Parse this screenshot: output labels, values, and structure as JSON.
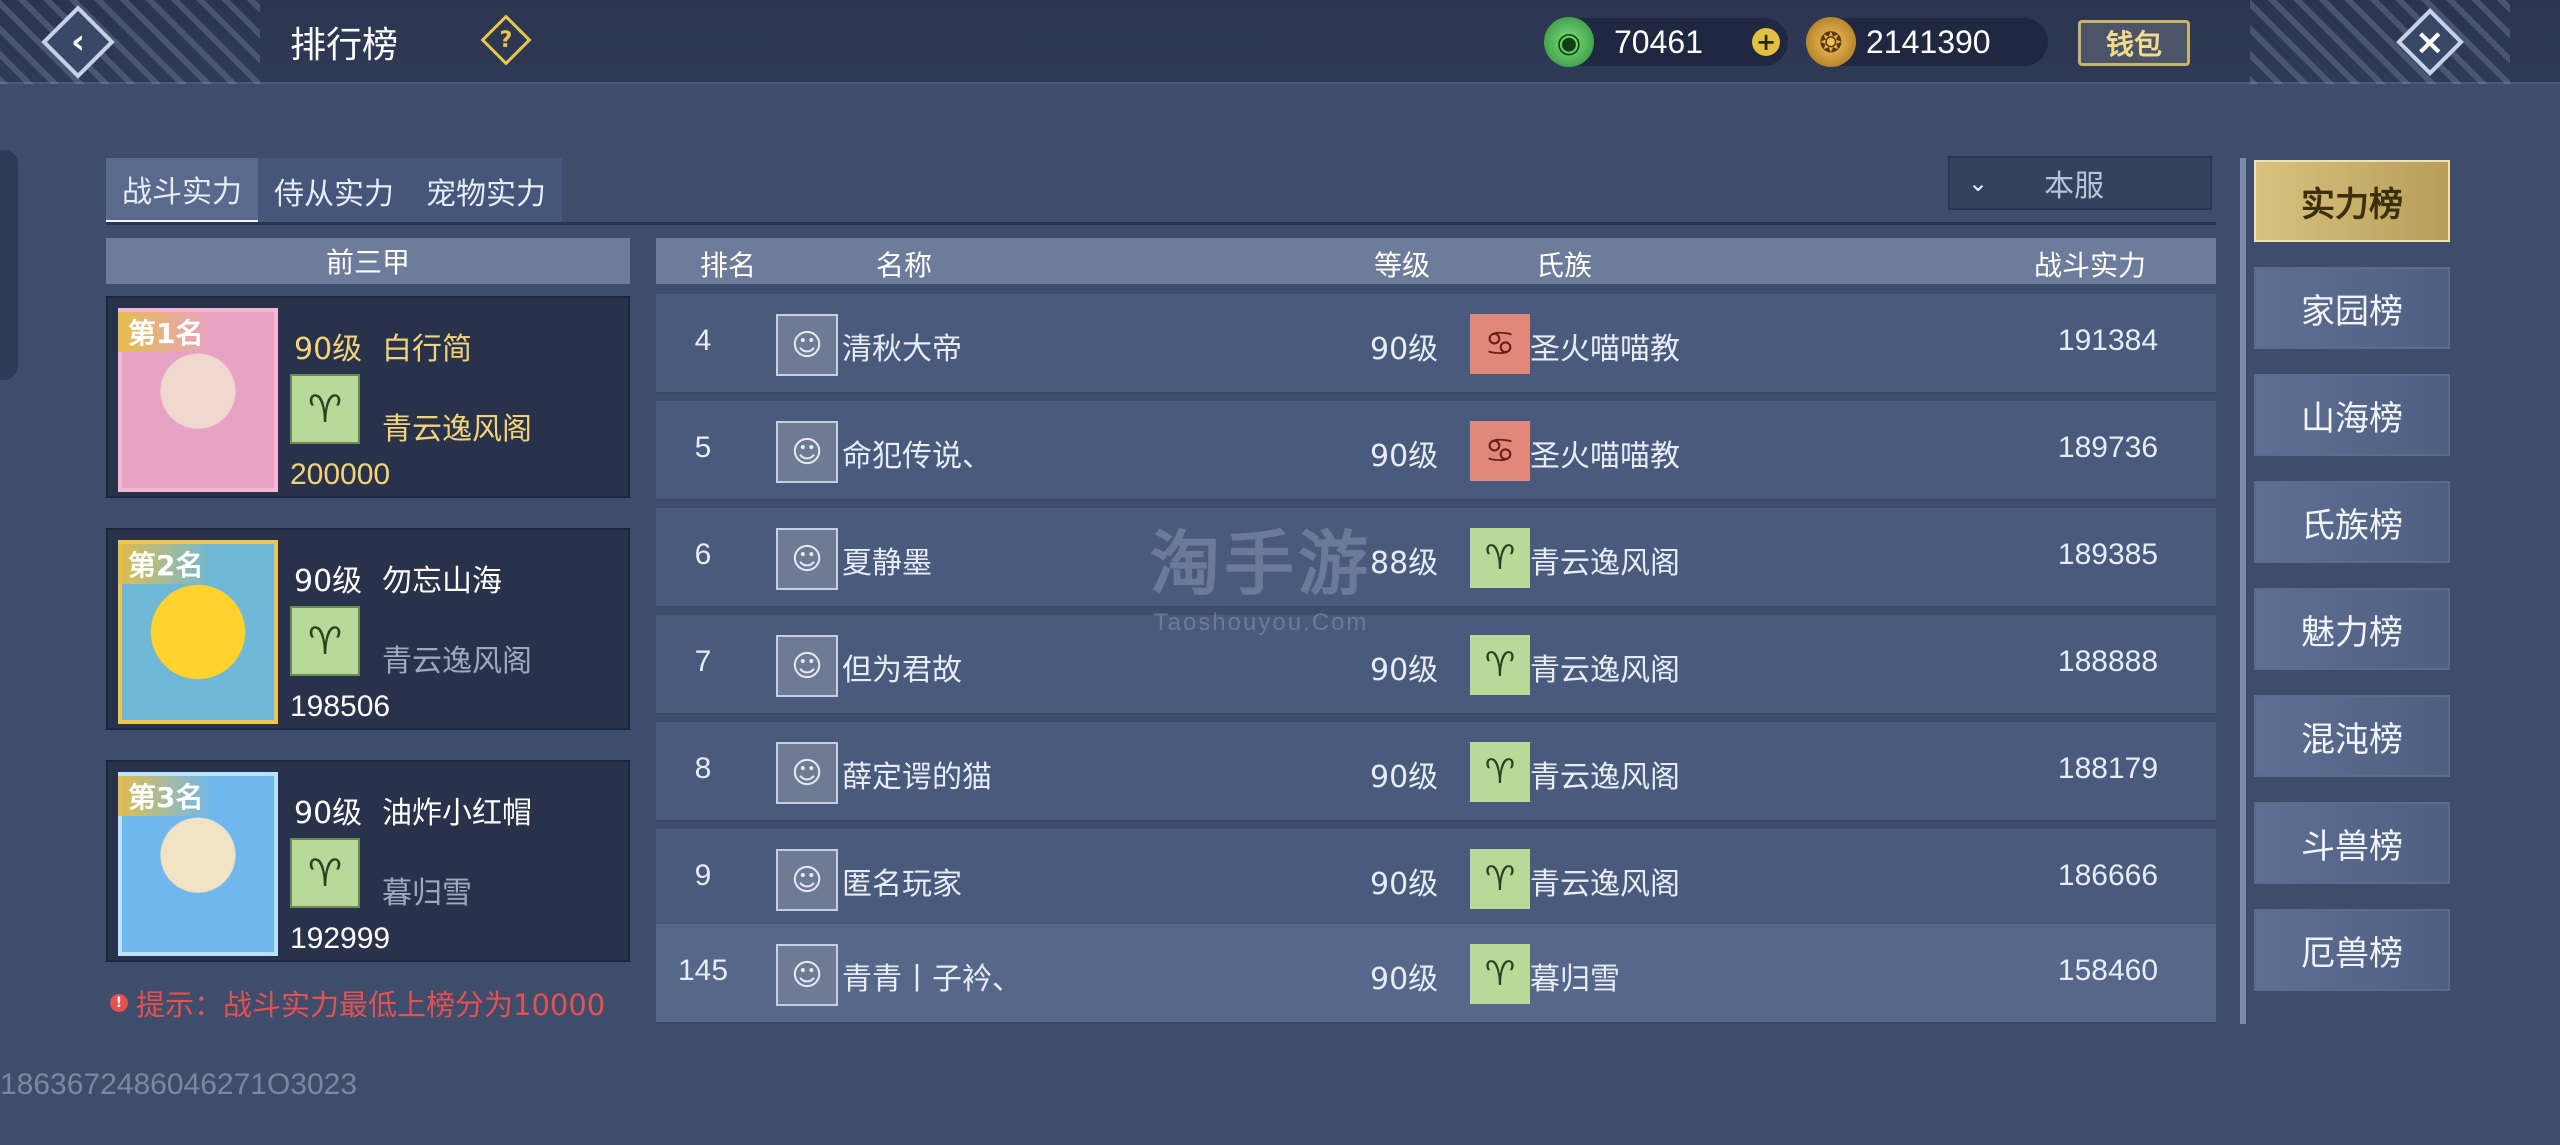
{
  "header": {
    "title": "排行榜",
    "jade_amount": "70461",
    "gold_amount": "2141390",
    "wallet_label": "钱包"
  },
  "tabs": [
    {
      "label": "战斗实力",
      "active": true
    },
    {
      "label": "侍从实力",
      "active": false
    },
    {
      "label": "宠物实力",
      "active": false
    }
  ],
  "server_filter": {
    "value": "本服"
  },
  "top_three": {
    "header": "前三甲",
    "entries": [
      {
        "rank_label": "第1名",
        "level": "90级",
        "name": "白行简",
        "clan": "青云逸风阁",
        "power": "200000"
      },
      {
        "rank_label": "第2名",
        "level": "90级",
        "name": "勿忘山海",
        "clan": "青云逸风阁",
        "power": "198506"
      },
      {
        "rank_label": "第3名",
        "level": "90级",
        "name": "油炸小红帽",
        "clan": "暮归雪",
        "power": "192999"
      }
    ]
  },
  "table": {
    "columns": [
      "排名",
      "名称",
      "等级",
      "氏族",
      "战斗实力"
    ],
    "rows": [
      {
        "rank": "4",
        "name": "清秋大帝",
        "level": "90级",
        "clan": "圣火喵喵教",
        "power": "191384",
        "clan_color": "red"
      },
      {
        "rank": "5",
        "name": "命犯传说、",
        "level": "90级",
        "clan": "圣火喵喵教",
        "power": "189736",
        "clan_color": "red"
      },
      {
        "rank": "6",
        "name": "夏静墨",
        "level": "88级",
        "clan": "青云逸风阁",
        "power": "189385",
        "clan_color": "green"
      },
      {
        "rank": "7",
        "name": "但为君故",
        "level": "90级",
        "clan": "青云逸风阁",
        "power": "188888",
        "clan_color": "green"
      },
      {
        "rank": "8",
        "name": "薛定谔的猫",
        "level": "90级",
        "clan": "青云逸风阁",
        "power": "188179",
        "clan_color": "green"
      },
      {
        "rank": "9",
        "name": "匿名玩家",
        "level": "90级",
        "clan": "青云逸风阁",
        "power": "186666",
        "clan_color": "green"
      }
    ],
    "my_row": {
      "rank": "145",
      "name": "青青丨子衿、",
      "level": "90级",
      "clan": "暮归雪",
      "power": "158460"
    }
  },
  "hint": "提示：战斗实力最低上榜分为10000",
  "uid": "1863672486046271O3023",
  "watermark": {
    "main": "淘手游",
    "sub": "Taoshouyou.Com"
  },
  "side_menu": [
    {
      "label": "实力榜",
      "active": true
    },
    {
      "label": "家园榜",
      "active": false
    },
    {
      "label": "山海榜",
      "active": false
    },
    {
      "label": "氏族榜",
      "active": false
    },
    {
      "label": "魅力榜",
      "active": false
    },
    {
      "label": "混沌榜",
      "active": false
    },
    {
      "label": "斗兽榜",
      "active": false
    },
    {
      "label": "厄兽榜",
      "active": false
    }
  ],
  "icons": {
    "back": "chevron-left-icon",
    "help": "question-icon",
    "jade": "jade-coin-icon",
    "gold": "gold-coin-icon",
    "plus": "plus-icon",
    "close": "close-icon",
    "clan": "clan-emblem-icon",
    "dropdown": "chevron-down-icon",
    "warning": "warning-icon"
  },
  "colors": {
    "accent_gold": "#d8c27e",
    "hint_red": "#e4514e",
    "top_name_gold": "#f2d37a"
  }
}
